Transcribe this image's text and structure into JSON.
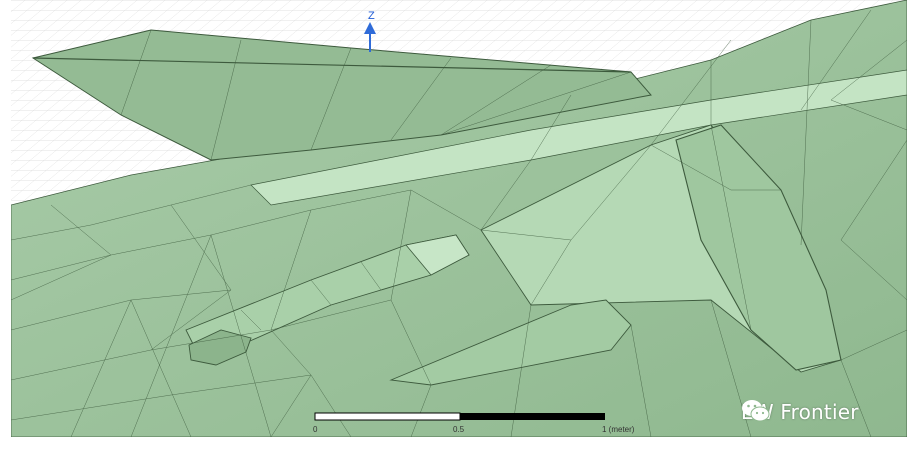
{
  "viewport": {
    "axis_label": "Z",
    "axis_color": "#2f6bd8",
    "mesh_fill": "#9bc29b",
    "mesh_fill_light": "#bfe2bf",
    "mesh_fill_dark": "#7faa7f",
    "mesh_edge": "#3d5a3d",
    "grid_color": "#d9d9d9"
  },
  "scale_bar": {
    "labels": [
      "0",
      "0.5",
      "1 (meter)"
    ]
  },
  "watermark": {
    "icon": "wechat-icon",
    "text": "EW Frontier"
  }
}
